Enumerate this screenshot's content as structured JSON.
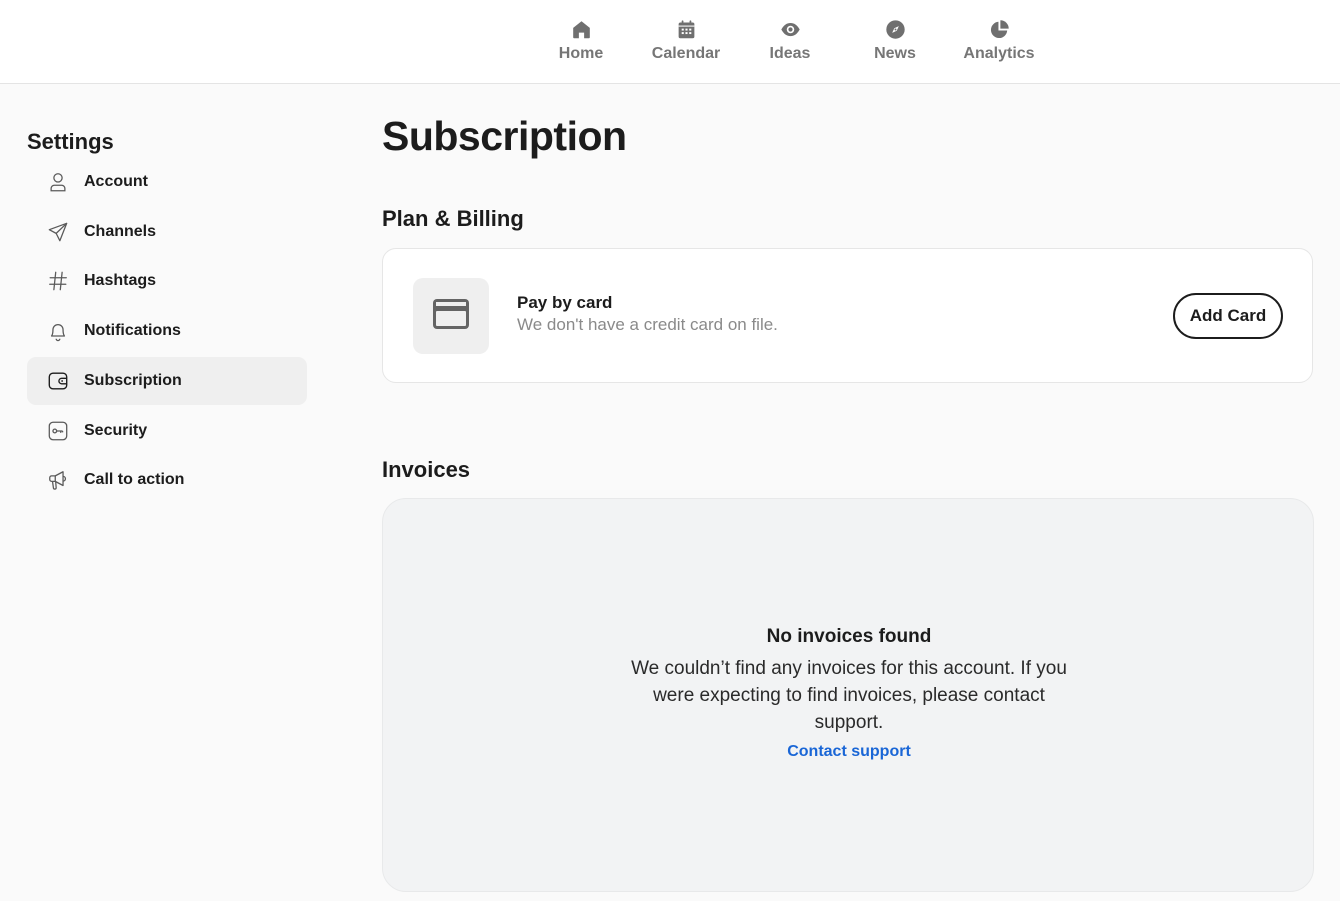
{
  "nav": {
    "items": [
      {
        "label": "Home",
        "icon": "home-icon"
      },
      {
        "label": "Calendar",
        "icon": "calendar-icon"
      },
      {
        "label": "Ideas",
        "icon": "eye-icon"
      },
      {
        "label": "News",
        "icon": "compass-icon"
      },
      {
        "label": "Analytics",
        "icon": "pie-chart-icon"
      }
    ]
  },
  "sidebar": {
    "title": "Settings",
    "items": [
      {
        "label": "Account",
        "icon": "user-icon"
      },
      {
        "label": "Channels",
        "icon": "send-icon"
      },
      {
        "label": "Hashtags",
        "icon": "hashtag-icon"
      },
      {
        "label": "Notifications",
        "icon": "bell-icon"
      },
      {
        "label": "Subscription",
        "icon": "wallet-icon",
        "active": true
      },
      {
        "label": "Security",
        "icon": "key-icon"
      },
      {
        "label": "Call to action",
        "icon": "megaphone-icon"
      }
    ]
  },
  "main": {
    "title": "Subscription",
    "billing": {
      "section_title": "Plan & Billing",
      "card_icon": "credit-card-icon",
      "card_title": "Pay by card",
      "card_subtitle": "We don't have a credit card on file.",
      "add_card_label": "Add Card"
    },
    "invoices": {
      "section_title": "Invoices",
      "empty_title": "No invoices found",
      "empty_body": "We couldn’t find any invoices for this account. If you were expecting to find invoices, please contact support.",
      "contact_label": "Contact support"
    }
  },
  "colors": {
    "link": "#1a66d6",
    "nav_text": "#767676",
    "active_bg": "#efefef",
    "panel_bg": "#f2f3f4"
  }
}
